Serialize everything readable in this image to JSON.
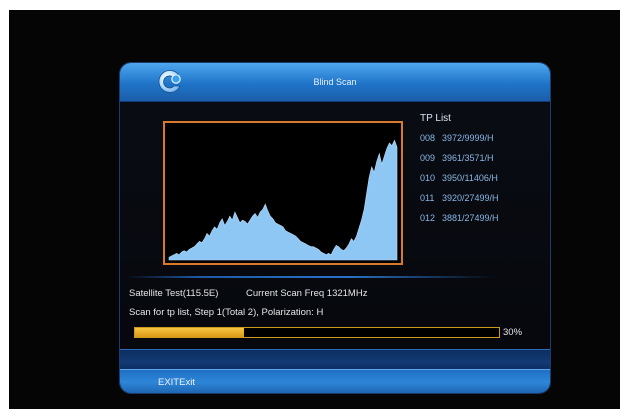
{
  "dialog": {
    "title": "Blind Scan"
  },
  "tp_list": {
    "title": "TP List",
    "items": [
      {
        "index": "008",
        "value": "3972/9999/H"
      },
      {
        "index": "009",
        "value": "3961/3571/H"
      },
      {
        "index": "010",
        "value": "3950/11406/H"
      },
      {
        "index": "011",
        "value": "3920/27499/H"
      },
      {
        "index": "012",
        "value": "3881/27499/H"
      }
    ]
  },
  "status": {
    "satellite": "Satellite Test(115.5E)",
    "current_freq": "Current Scan Freq 1321MHz",
    "step": "Scan for tp list, Step 1(Total 2),  Polarization: H"
  },
  "progress": {
    "value": 0.3,
    "label": "30%"
  },
  "footer": {
    "exit_label": "EXITExit"
  },
  "colors": {
    "header_blue": "#2e86d8",
    "graph_border": "#d87a2a",
    "graph_fill": "#8ec6f4",
    "progress_fill": "#f0b830",
    "tp_text": "#8ab7e4"
  },
  "icons": {
    "logo": "circular-arrow-logo-icon"
  },
  "chart_data": {
    "type": "area",
    "values": [
      2,
      3,
      4,
      5,
      4,
      6,
      7,
      6,
      8,
      9,
      10,
      12,
      14,
      13,
      16,
      20,
      18,
      22,
      25,
      23,
      28,
      31,
      26,
      29,
      33,
      30,
      36,
      32,
      28,
      30,
      29,
      27,
      30,
      33,
      35,
      32,
      36,
      38,
      42,
      37,
      33,
      31,
      28,
      27,
      26,
      25,
      22,
      21,
      20,
      19,
      18,
      16,
      14,
      13,
      12,
      11,
      10,
      10,
      9,
      8,
      6,
      5,
      4,
      5,
      4,
      8,
      11,
      10,
      8,
      7,
      9,
      12,
      16,
      14,
      18,
      24,
      30,
      38,
      50,
      62,
      70,
      66,
      74,
      80,
      72,
      78,
      84,
      88,
      86,
      90,
      85
    ],
    "ylim": [
      0,
      100
    ]
  }
}
